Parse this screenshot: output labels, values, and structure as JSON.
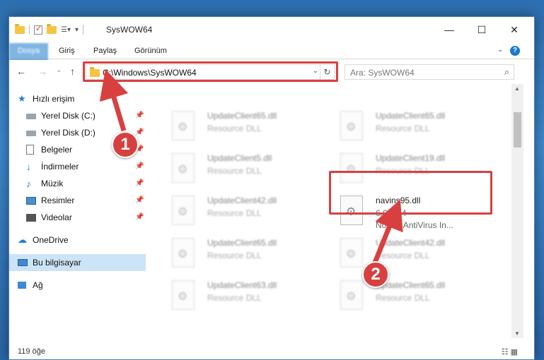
{
  "window": {
    "title": "SysWOW64",
    "controls": {
      "minimize": "—",
      "maximize": "☐",
      "close": "✕"
    }
  },
  "ribbon": {
    "tabs": [
      "Dosya",
      "Giriş",
      "Paylaş",
      "Görünüm"
    ],
    "help": "?"
  },
  "nav": {
    "back": "←",
    "forward": "→",
    "recent": "⌄",
    "up": "↑",
    "address": "C:\\Windows\\SysWOW64",
    "search_placeholder": "Ara: SysWOW64"
  },
  "sidebar": {
    "quick_access": "Hızlı erişim",
    "items": [
      {
        "label": "Yerel Disk (C:)",
        "icon": "drive-icon",
        "pinned": true
      },
      {
        "label": "Yerel Disk (D:)",
        "icon": "drive-icon",
        "pinned": true
      },
      {
        "label": "Belgeler",
        "icon": "documents-icon",
        "pinned": true
      },
      {
        "label": "İndirmeler",
        "icon": "download-icon",
        "pinned": true
      },
      {
        "label": "Müzik",
        "icon": "music-icon",
        "pinned": true
      },
      {
        "label": "Resimler",
        "icon": "pictures-icon",
        "pinned": true
      },
      {
        "label": "Videolar",
        "icon": "videos-icon",
        "pinned": true
      }
    ],
    "onedrive": "OneDrive",
    "this_pc": "Bu bilgisayar",
    "network": "Ağ"
  },
  "files": [
    {
      "name": "UpdateClient65.dll",
      "type": "Resource DLL"
    },
    {
      "name": "UpdateClient65.dll",
      "type": "Resource DLL"
    },
    {
      "name": "UpdateClient5.dll",
      "type": "Resource DLL"
    },
    {
      "name": "UpdateClient19.dll",
      "type": "Resource DLL"
    },
    {
      "name": "UpdateClient42.dll",
      "type": "Resource DLL"
    },
    {
      "name": "navins95.dll",
      "version": "6.0.3.24",
      "company": "Norton AntiVirus In..."
    },
    {
      "name": "UpdateClient65.dll",
      "type": "Resource DLL"
    },
    {
      "name": "UpdateClient42.dll",
      "type": "Resource DLL"
    },
    {
      "name": "UpdateClient63.dll",
      "type": "Resource DLL"
    },
    {
      "name": "UpdateClient65.dll",
      "type": "Resource DLL"
    }
  ],
  "status": {
    "count": "119 öğe"
  },
  "callouts": [
    "1",
    "2"
  ],
  "colors": {
    "accent": "#1979ca",
    "highlight": "#d84040",
    "selected": "#cce4f7"
  }
}
